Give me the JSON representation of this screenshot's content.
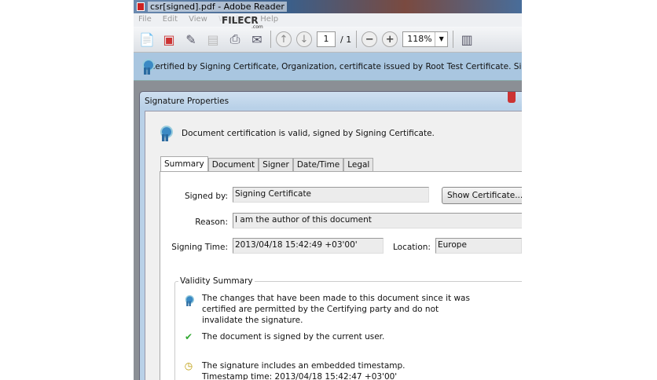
{
  "window": {
    "title": "csr[signed].pdf - Adobe Reader"
  },
  "menu": [
    "File",
    "Edit",
    "View",
    "Window",
    "Help"
  ],
  "watermark": {
    "text": "FILECR",
    "sub": ".com"
  },
  "toolbar": {
    "page_current": "1",
    "page_total": "/ 1",
    "zoom": "118%"
  },
  "cert_bar": {
    "text": "Certified by Signing Certificate, Organization, certificate issued by Root Test Certificate. Signed and"
  },
  "dialog": {
    "title": "Signature Properties",
    "header": "Document certification is valid, signed by Signing Certificate.",
    "tabs": [
      "Summary",
      "Document",
      "Signer",
      "Date/Time",
      "Legal"
    ],
    "signed_by_label": "Signed by:",
    "signed_by": "Signing Certificate",
    "show_cert": "Show Certificate...",
    "reason_label": "Reason:",
    "reason": "I am the author of this document",
    "time_label": "Signing Time:",
    "time": "2013/04/18 15:42:49 +03'00'",
    "location_label": "Location:",
    "location": "Europe",
    "validity_title": "Validity Summary",
    "validity": [
      "The changes that have been made to this document since it was certified are permitted by the Certifying party and do not invalidate the signature.",
      "The document is signed by the current user.",
      "The signature includes an embedded timestamp. Timestamp time: 2013/04/18 15:42:47 +03'00'"
    ]
  }
}
